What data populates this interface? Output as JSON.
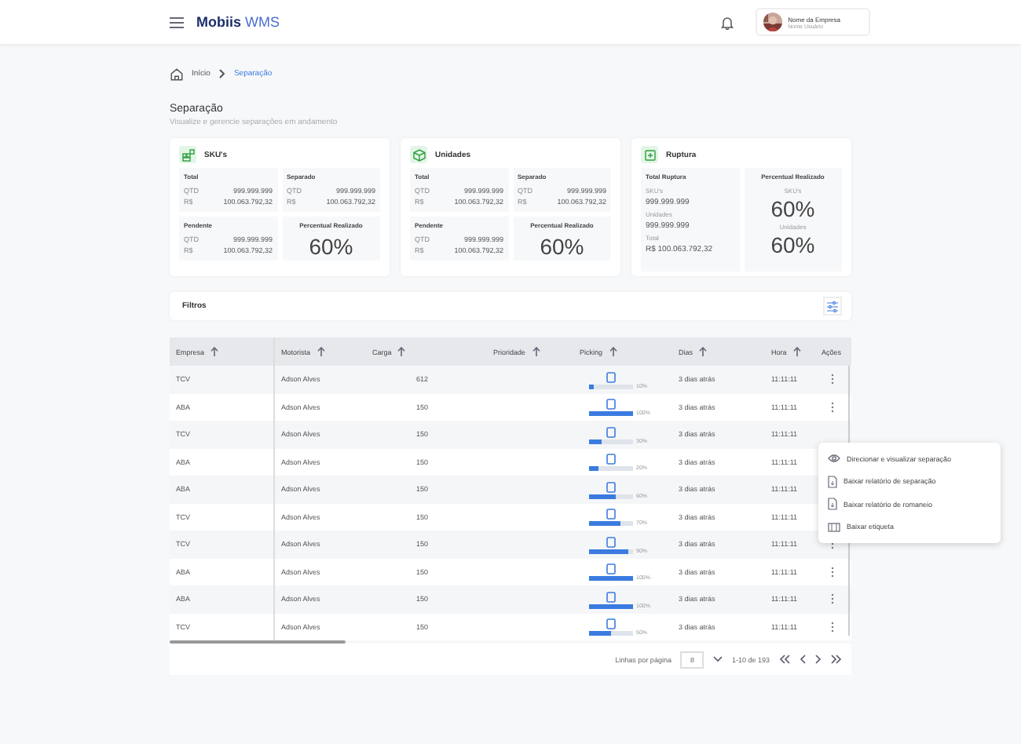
{
  "header": {
    "brand": "Mobiis",
    "brand_suffix": "WMS",
    "company": "Nome da Empresa",
    "user": "Nome Usuário"
  },
  "breadcrumb": [
    {
      "label": "Início",
      "selected": false
    },
    {
      "label": "Separação",
      "selected": true
    }
  ],
  "page": {
    "title": "Separação",
    "subtitle": "Visualize e gerencie separações em andamento"
  },
  "cards": [
    {
      "kind": "standard",
      "title": "SKU's",
      "blocks": [
        {
          "label": "Total",
          "qtd_label": "QTD",
          "qtd": "999.999.999",
          "rs_label": "R$",
          "rs": "100.063.792,32"
        },
        {
          "label": "Separado",
          "qtd_label": "QTD",
          "qtd": "999.999.999",
          "rs_label": "R$",
          "rs": "100.063.792,32"
        },
        {
          "label": "Pendente",
          "qtd_label": "QTD",
          "qtd": "999.999.999",
          "rs_label": "R$",
          "rs": "100.063.792,32"
        }
      ],
      "percent_label": "Percentual Realizado",
      "percent": "60%"
    },
    {
      "kind": "standard",
      "title": "Unidades",
      "blocks": [
        {
          "label": "Total",
          "qtd_label": "QTD",
          "qtd": "999.999.999",
          "rs_label": "R$",
          "rs": "100.063.792,32"
        },
        {
          "label": "Separado",
          "qtd_label": "QTD",
          "qtd": "999.999.999",
          "rs_label": "R$",
          "rs": "100.063.792,32"
        },
        {
          "label": "Pendente",
          "qtd_label": "QTD",
          "qtd": "999.999.999",
          "rs_label": "R$",
          "rs": "100.063.792,32"
        }
      ],
      "percent_label": "Percentual Realizado",
      "percent": "60%"
    },
    {
      "kind": "rupture",
      "title": "Ruptura",
      "total_label": "Total Ruptura",
      "items": [
        {
          "label": "SKU's",
          "value": "999.999.999"
        },
        {
          "label": "Unidades",
          "value": "999.999.999"
        },
        {
          "label": "Total",
          "value": "R$ 100.063.792,32"
        }
      ],
      "percent_label": "Percentual Realizado",
      "percents": [
        {
          "label": "SKU's",
          "value": "60%"
        },
        {
          "label": "Unidades",
          "value": "60%"
        }
      ]
    }
  ],
  "filters": {
    "label": "Filtros"
  },
  "table": {
    "columns": [
      {
        "label": "Empresa",
        "sortable": true
      },
      {
        "label": "Motorista",
        "sortable": true
      },
      {
        "label": "Carga",
        "sortable": true
      },
      {
        "label": "Prioridade",
        "sortable": true
      },
      {
        "label": "Picking",
        "sortable": true
      },
      {
        "label": "Dias",
        "sortable": true
      },
      {
        "label": "Hora",
        "sortable": true
      },
      {
        "label": "Ações",
        "sortable": false
      }
    ],
    "rows": [
      {
        "empresa": "TCV",
        "motorista": "Adson Alves",
        "carga": "612",
        "level": 0.1,
        "percent": "10%",
        "dias": "3 dias atrás",
        "hora": "11:11:11",
        "actions_covered": false
      },
      {
        "empresa": "ABA",
        "motorista": "Adson Alves",
        "carga": "150",
        "level": 1,
        "percent": "100%",
        "dias": "3 dias atrás",
        "hora": "11:11:11",
        "actions_covered": false
      },
      {
        "empresa": "TCV",
        "motorista": "Adson Alves",
        "carga": "150",
        "level": 0.3,
        "percent": "30%",
        "dias": "3 dias atrás",
        "hora": "11:11:11",
        "actions_covered": true
      },
      {
        "empresa": "ABA",
        "motorista": "Adson Alves",
        "carga": "150",
        "level": 0.2,
        "percent": "20%",
        "dias": "3 dias atrás",
        "hora": "11:11:11",
        "actions_covered": true
      },
      {
        "empresa": "ABA",
        "motorista": "Adson Alves",
        "carga": "150",
        "level": 0.6,
        "percent": "60%",
        "dias": "3 dias atrás",
        "hora": "11:11:11",
        "actions_covered": true
      },
      {
        "empresa": "TCV",
        "motorista": "Adson Alves",
        "carga": "150",
        "level": 0.7,
        "percent": "70%",
        "dias": "3 dias atrás",
        "hora": "11:11:11",
        "actions_covered": true
      },
      {
        "empresa": "TCV",
        "motorista": "Adson Alves",
        "carga": "150",
        "level": 0.9,
        "percent": "90%",
        "dias": "3 dias atrás",
        "hora": "11:11:11",
        "actions_covered": false
      },
      {
        "empresa": "ABA",
        "motorista": "Adson Alves",
        "carga": "150",
        "level": 1,
        "percent": "100%",
        "dias": "3 dias atrás",
        "hora": "11:11:11",
        "actions_covered": false
      },
      {
        "empresa": "ABA",
        "motorista": "Adson Alves",
        "carga": "150",
        "level": 1,
        "percent": "100%",
        "dias": "3 dias atrás",
        "hora": "11:11:11",
        "actions_covered": false
      },
      {
        "empresa": "TCV",
        "motorista": "Adson Alves",
        "carga": "150",
        "level": 0.5,
        "percent": "50%",
        "dias": "3 dias atrás",
        "hora": "11:11:11",
        "actions_covered": false
      }
    ]
  },
  "pagination": {
    "rows_label": "Linhas por página",
    "rows_per_page": "8",
    "range": "1-10 de 193"
  },
  "menu": [
    {
      "label": "Direcionar e visualizar separação"
    },
    {
      "label": "Baixar relatório de separação"
    },
    {
      "label": "Baixar relatório de romaneio"
    },
    {
      "label": "Baixar etiqueta"
    }
  ]
}
